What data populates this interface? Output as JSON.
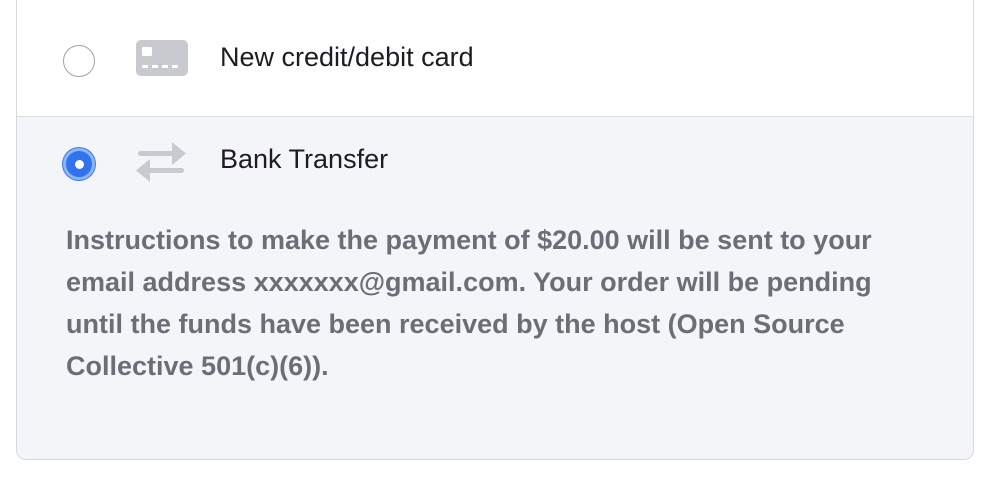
{
  "payment_options": [
    {
      "id": "card",
      "label": "New credit/debit card",
      "icon": "credit-card-icon",
      "selected": false
    },
    {
      "id": "bank",
      "label": "Bank Transfer",
      "icon": "transfer-arrows-icon",
      "selected": true,
      "instructions": "Instructions to make the payment of $20.00 will be sent to your email address xxxxxxx@gmail.com. Your order will be pending until the funds have been received by the host (Open Source Collective 501(c)(6))."
    }
  ],
  "colors": {
    "accent": "#3172ed",
    "selected_background": "#f4f5f9",
    "border": "#d6d8de",
    "muted_text": "#6b6e76",
    "icon_gray": "#c8cacf"
  }
}
